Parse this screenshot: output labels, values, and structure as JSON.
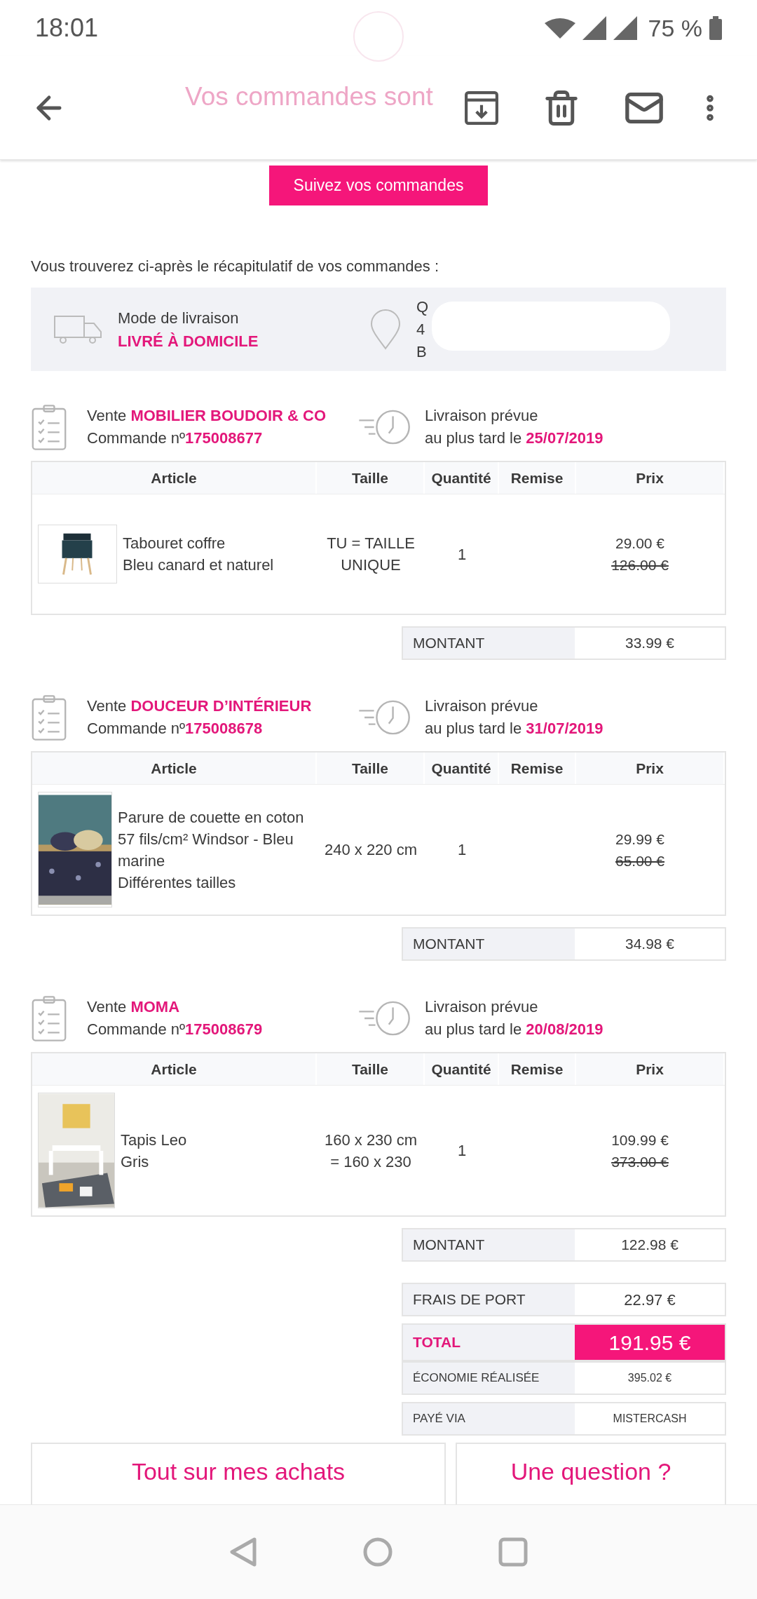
{
  "status_bar": {
    "time": "18:01",
    "battery": "75 %"
  },
  "header": {
    "title": "Vos commandes sont"
  },
  "track_button": "Suivez vos commandes",
  "intro": "Vous trouverez ci-après le récapitulatif de vos commandes :",
  "delivery": {
    "label": "Mode de livraison",
    "mode": "LIVRÉ À DOMICILE",
    "address_lines": [
      "Q",
      "4",
      "B"
    ]
  },
  "orders": [
    {
      "vente_label": "Vente",
      "vendor": "MOBILIER BOUDOIR & CO",
      "order_label": "Commande nº",
      "order_number": "175008677",
      "delivery_label": "Livraison prévue",
      "date_label": "au plus tard le",
      "date": "25/07/2019",
      "columns": [
        "Article",
        "Taille",
        "Quantité",
        "Remise",
        "Prix"
      ],
      "items": [
        {
          "picture": {
            "kind": "picture"
          },
          "name_lines": [
            "Tabouret coffre",
            "Bleu canard et naturel"
          ],
          "size": "TU = TAILLE UNIQUE",
          "quantity": "1",
          "price": "29.00 €",
          "old_price": "126.00 €"
        }
      ],
      "amount_label": "MONTANT",
      "amount": "33.99 €"
    },
    {
      "vente_label": "Vente",
      "vendor": "DOUCEUR D’INTÉRIEUR",
      "order_label": "Commande nº",
      "order_number": "175008678",
      "delivery_label": "Livraison prévue",
      "date_label": "au plus tard le",
      "date": "31/07/2019",
      "columns": [
        "Article",
        "Taille",
        "Quantité",
        "Remise",
        "Prix"
      ],
      "items": [
        {
          "picture": {
            "kind": "picture"
          },
          "name_lines": [
            "Parure de couette en coton 57 fils/cm² Windsor - Bleu marine",
            "Différentes tailles"
          ],
          "size": "240 x 220 cm",
          "quantity": "1",
          "price": "29.99 €",
          "old_price": "65.00 €"
        }
      ],
      "amount_label": "MONTANT",
      "amount": "34.98 €"
    },
    {
      "vente_label": "Vente",
      "vendor": "MOMA",
      "order_label": "Commande nº",
      "order_number": "175008679",
      "delivery_label": "Livraison prévue",
      "date_label": "au plus tard le",
      "date": "20/08/2019",
      "columns": [
        "Article",
        "Taille",
        "Quantité",
        "Remise",
        "Prix"
      ],
      "items": [
        {
          "picture": {
            "kind": "picture"
          },
          "name_lines": [
            "Tapis Leo",
            "Gris"
          ],
          "size": "160 x 230 cm = 160 x 230",
          "quantity": "1",
          "price": "109.99 €",
          "old_price": "373.00 €"
        }
      ],
      "amount_label": "MONTANT",
      "amount": "122.98 €"
    }
  ],
  "summary": [
    {
      "kind": "normal",
      "label": "FRAIS DE PORT",
      "value": "22.97 €"
    },
    {
      "kind": "total",
      "label": "TOTAL",
      "value": "191.95 €"
    },
    {
      "kind": "small",
      "label": "ÉCONOMIE RÉALISÉE",
      "value": "395.02 €"
    },
    {
      "kind": "small",
      "label": "PAYÉ VIA",
      "value": "MISTERCASH"
    }
  ],
  "cards": [
    {
      "title": "Tout sur mes achats"
    },
    {
      "title": "Une question ?"
    }
  ]
}
